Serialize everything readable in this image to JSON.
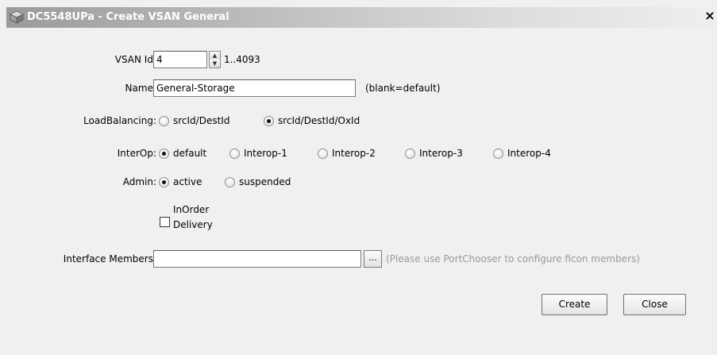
{
  "window": {
    "title": "DC5548UPa - Create VSAN General",
    "close_glyph": "×"
  },
  "form": {
    "vsan_id": {
      "label": "VSAN Id:",
      "value": "4",
      "range": "1..4093"
    },
    "name": {
      "label": "Name:",
      "value": "General-Storage",
      "hint": "(blank=default)"
    },
    "load_balancing": {
      "label": "LoadBalancing:",
      "options": [
        {
          "label": "srcId/DestId",
          "selected": false
        },
        {
          "label": "srcId/DestId/OxId",
          "selected": true
        }
      ]
    },
    "interop": {
      "label": "InterOp:",
      "options": [
        {
          "label": "default",
          "selected": true
        },
        {
          "label": "Interop-1",
          "selected": false
        },
        {
          "label": "Interop-2",
          "selected": false
        },
        {
          "label": "Interop-3",
          "selected": false
        },
        {
          "label": "Interop-4",
          "selected": false
        }
      ]
    },
    "admin": {
      "label": "Admin:",
      "options": [
        {
          "label": "active",
          "selected": true
        },
        {
          "label": "suspended",
          "selected": false
        }
      ]
    },
    "in_order_delivery": {
      "label_line1": "InOrder",
      "label_line2": "Delivery",
      "checked": false
    },
    "interface_members": {
      "label": "Interface Members:",
      "value": "",
      "browse_label": "...",
      "hint": "(Please use PortChooser to configure ficon members)"
    }
  },
  "buttons": {
    "create_label": "Create",
    "close_label": "Close"
  }
}
